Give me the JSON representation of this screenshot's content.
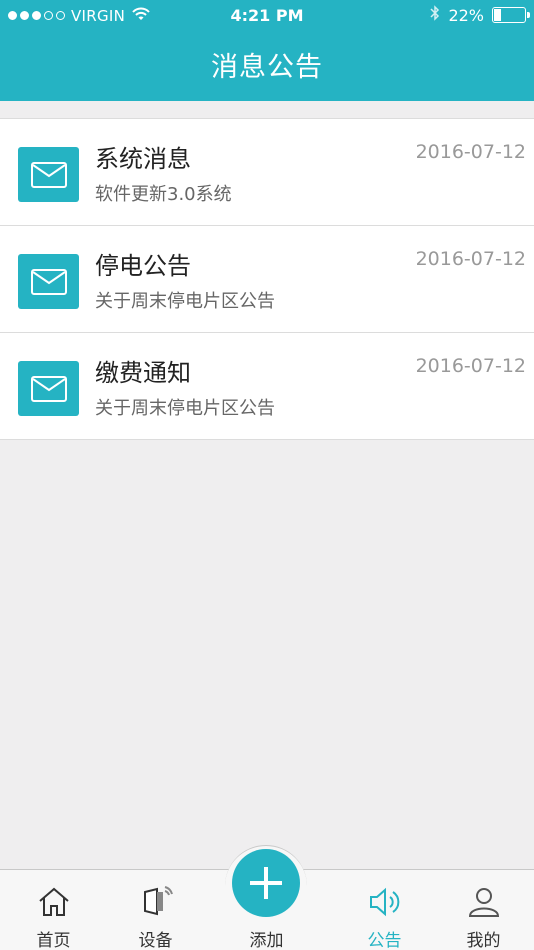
{
  "status_bar": {
    "carrier": "VIRGIN",
    "time": "4:21 PM",
    "battery": "22%",
    "battery_level": 0.22
  },
  "nav": {
    "title": "消息公告"
  },
  "messages": [
    {
      "title": "系统消息",
      "subtitle": "软件更新3.0系统",
      "date": "2016-07-12",
      "icon": "mail-icon"
    },
    {
      "title": "停电公告",
      "subtitle": "关于周末停电片区公告",
      "date": "2016-07-12",
      "icon": "mail-icon"
    },
    {
      "title": "缴费通知",
      "subtitle": "关于周末停电片区公告",
      "date": "2016-07-12",
      "icon": "mail-icon"
    }
  ],
  "tabbar": {
    "home": {
      "label": "首页",
      "icon": "home-icon"
    },
    "device": {
      "label": "设备",
      "icon": "device-icon"
    },
    "add": {
      "label": "添加",
      "icon": "plus-icon"
    },
    "notice": {
      "label": "公告",
      "icon": "speaker-icon",
      "active": true
    },
    "mine": {
      "label": "我的",
      "icon": "user-icon"
    }
  },
  "colors": {
    "accent": "#25b3c3",
    "background": "#efeeef",
    "text_primary": "#222222",
    "text_secondary": "#666666",
    "date": "#999999"
  }
}
